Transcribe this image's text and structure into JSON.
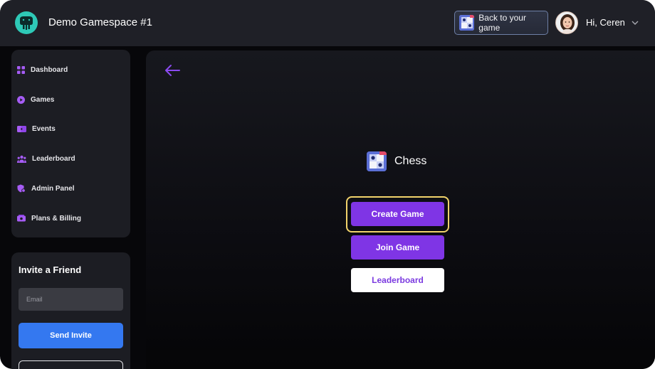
{
  "header": {
    "app_title": "Demo Gamespace #1",
    "back_button_label": "Back to your game",
    "greeting": "Hi, Ceren"
  },
  "sidebar": {
    "items": [
      {
        "label": "Dashboard",
        "icon": "grid-icon"
      },
      {
        "label": "Games",
        "icon": "play-circle-icon"
      },
      {
        "label": "Events",
        "icon": "tickets-icon"
      },
      {
        "label": "Leaderboard",
        "icon": "users-group-icon"
      },
      {
        "label": "Admin Panel",
        "icon": "admin-shield-icon"
      },
      {
        "label": "Plans & Billing",
        "icon": "billing-icon"
      }
    ]
  },
  "invite": {
    "title": "Invite a Friend",
    "email_placeholder": "Email",
    "send_label": "Send Invite"
  },
  "game": {
    "title": "Chess",
    "actions": {
      "create": "Create Game",
      "join": "Join Game",
      "leaderboard": "Leaderboard"
    }
  },
  "colors": {
    "accent_purple": "#7f35e5",
    "send_blue": "#3478f0",
    "focus_ring": "#f1d36b",
    "logo_teal": "#2ec9b7"
  }
}
